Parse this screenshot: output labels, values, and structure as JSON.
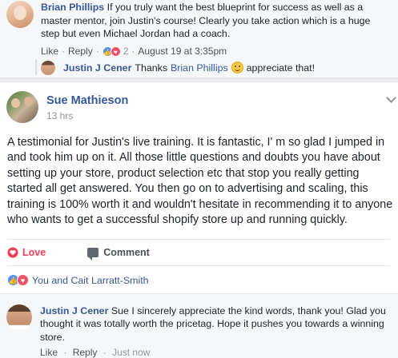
{
  "top_comment": {
    "author": "Brian Phillips",
    "text": "If you truly want the best blueprint for success as well as a master mentor, join Justin's course! Clearly you take action which is a huge step but even Michael Jordan had a coach.",
    "like_label": "Like",
    "reply_label": "Reply",
    "reaction_count": "2",
    "timestamp": "August 19 at 3:35pm"
  },
  "top_reply": {
    "author": "Justin J Cener",
    "text_before": "Thanks",
    "mention": "Brian Phillips",
    "text_after": "appreciate that!"
  },
  "post": {
    "author": "Sue Mathieson",
    "time": "13 hrs",
    "text": "A testimonial for Justin's live training. It is fantastic, I' m so glad I jumped in and took him up on it. All those little questions and doubts you have about setting up your store, product selection etc that stop you really getting started all get answered. You then go on to advertising and scaling, this training is 100% worth it and wouldn't hesitate in recommending it to anyone who wants to get a successful shopify store up and running quickly.",
    "love_label": "Love",
    "comment_label": "Comment",
    "reactions_text": "You and Cait Larratt-Smith"
  },
  "post_comment": {
    "author": "Justin J Cener",
    "text": "Sue I sincerely appreciate the kind words, thank you! Glad you thought it was totally worth the pricetag. Hope it pushes you towards a winning store.",
    "like_label": "Like",
    "reply_label": "Reply",
    "timestamp": "Just now"
  },
  "colors": {
    "link_blue": "#365899",
    "love_red": "#f33e58",
    "meta_gray": "#90949c"
  }
}
